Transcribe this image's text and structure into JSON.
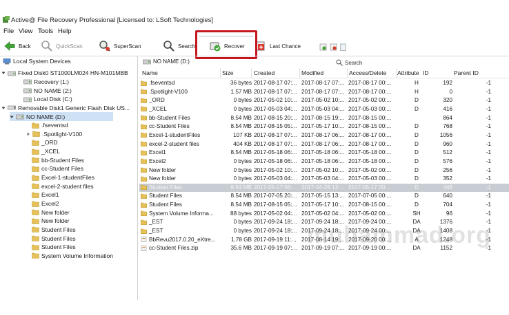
{
  "window": {
    "title": "Active@ File Recovery Professional [Licensed to: LSoft Technologies]"
  },
  "menu": [
    "File",
    "View",
    "Tools",
    "Help"
  ],
  "toolbar": {
    "back": "Back",
    "quickscan": "QuickScan",
    "superscan": "SuperScan",
    "search": "Search",
    "recover": "Recover",
    "last_chance": "Last Chance"
  },
  "tree": {
    "header": "Local System Devices",
    "nodes": [
      {
        "label": "Fixed Disk0 ST1000LM024 HN-M101MBB"
      },
      {
        "label": "Recovery (1:)"
      },
      {
        "label": "NO NAME (2:)"
      },
      {
        "label": "Local Disk (C:)"
      },
      {
        "label": "Removable Disk1 Generic Flash Disk US..."
      },
      {
        "label": "NO NAME (D:)"
      },
      {
        "label": ".fseventsd"
      },
      {
        "label": ".Spotlight-V100"
      },
      {
        "label": "_ORD"
      },
      {
        "label": "_XCEL"
      },
      {
        "label": "bb-Student Files"
      },
      {
        "label": "cc-Student Files"
      },
      {
        "label": "Excel-1-studentFiles"
      },
      {
        "label": "excel-2-student files"
      },
      {
        "label": "Excel1"
      },
      {
        "label": "Excel2"
      },
      {
        "label": "New folder"
      },
      {
        "label": "New folder"
      },
      {
        "label": "Student Files"
      },
      {
        "label": "Student Files"
      },
      {
        "label": "Student Files"
      },
      {
        "label": "System Volume Information"
      }
    ]
  },
  "path": {
    "current": "NO NAME (D:)",
    "search_tab": "Search"
  },
  "columns": {
    "name": "Name",
    "size": "Size",
    "created": "Created",
    "modified": "Modified",
    "accessed": "Access/Delete",
    "attribute": "Attribute",
    "id": "ID",
    "parent_id": "Parent ID"
  },
  "files": [
    {
      "name": ".fseventsd",
      "size": "36 bytes",
      "created": "2017-08-17 07:...",
      "modified": "2017-08-17 07:...",
      "accessed": "2017-08-17 00:...",
      "attr": "H",
      "id": "192",
      "pid": "-1"
    },
    {
      "name": ".Spotlight-V100",
      "size": "1.57 MB",
      "created": "2017-08-17 07:...",
      "modified": "2017-08-17 07:...",
      "accessed": "2017-08-17 00:...",
      "attr": "H",
      "id": "0",
      "pid": "-1"
    },
    {
      "name": "_ORD",
      "size": "0 bytes",
      "created": "2017-05-02 10:...",
      "modified": "2017-05-02 10:...",
      "accessed": "2017-05-02 00:...",
      "attr": "D",
      "id": "320",
      "pid": "-1"
    },
    {
      "name": "_XCEL",
      "size": "0 bytes",
      "created": "2017-05-03 04:...",
      "modified": "2017-05-03 04:...",
      "accessed": "2017-05-03 00:...",
      "attr": "D",
      "id": "416",
      "pid": "-1"
    },
    {
      "name": "bb-Student Files",
      "size": "8.54 MB",
      "created": "2017-08-15 20:...",
      "modified": "2017-08-15 19:...",
      "accessed": "2017-08-15 00:...",
      "attr": "",
      "id": "864",
      "pid": "-1"
    },
    {
      "name": "cc-Student Files",
      "size": "8.54 MB",
      "created": "2017-08-15 05:...",
      "modified": "2017-05-17 10:...",
      "accessed": "2017-08-15 00:...",
      "attr": "D",
      "id": "768",
      "pid": "-1"
    },
    {
      "name": "Excel-1-studentFiles",
      "size": "107 KB",
      "created": "2017-08-17 07:...",
      "modified": "2017-08-17 06:...",
      "accessed": "2017-08-17 00:...",
      "attr": "D",
      "id": "1056",
      "pid": "-1"
    },
    {
      "name": "excel-2-student files",
      "size": "404 KB",
      "created": "2017-08-17 07:...",
      "modified": "2017-08-17 06:...",
      "accessed": "2017-08-17 00:...",
      "attr": "D",
      "id": "960",
      "pid": "-1"
    },
    {
      "name": "Excel1",
      "size": "8.54 MB",
      "created": "2017-05-18 06:...",
      "modified": "2017-05-18 06:...",
      "accessed": "2017-05-18 00:...",
      "attr": "D",
      "id": "512",
      "pid": "-1"
    },
    {
      "name": "Excel2",
      "size": "0 bytes",
      "created": "2017-05-18 06:...",
      "modified": "2017-05-18 06:...",
      "accessed": "2017-05-18 00:...",
      "attr": "D",
      "id": "576",
      "pid": "-1"
    },
    {
      "name": "New folder",
      "size": "0 bytes",
      "created": "2017-05-02 10:...",
      "modified": "2017-05-02 10:...",
      "accessed": "2017-05-02 00:...",
      "attr": "D",
      "id": "256",
      "pid": "-1"
    },
    {
      "name": "New folder",
      "size": "0 bytes",
      "created": "2017-05-03 04:...",
      "modified": "2017-05-03 04:...",
      "accessed": "2017-05-03 00:...",
      "attr": "D",
      "id": "352",
      "pid": "-1"
    },
    {
      "name": "Student Files",
      "size": "8.54 MB",
      "created": "2017-05-17 06:...",
      "modified": "2017-04-29 13:...",
      "accessed": "2017-05-17 00:...",
      "attr": "D",
      "id": "448",
      "pid": "-1",
      "selected": true
    },
    {
      "name": "Student Files",
      "size": "8.54 MB",
      "created": "2017-07-05 20:...",
      "modified": "2017-05-15 13:...",
      "accessed": "2017-07-05 00:...",
      "attr": "D",
      "id": "640",
      "pid": "-1"
    },
    {
      "name": "Student Files",
      "size": "8.54 MB",
      "created": "2017-08-15 05:...",
      "modified": "2017-05-17 10:...",
      "accessed": "2017-08-15 00:...",
      "attr": "D",
      "id": "704",
      "pid": "-1"
    },
    {
      "name": "System Volume Informa...",
      "size": "88 bytes",
      "created": "2017-05-02 04:...",
      "modified": "2017-05-02 04:...",
      "accessed": "2017-05-02 00:...",
      "attr": "SH",
      "id": "96",
      "pid": "-1"
    },
    {
      "name": "_EST",
      "size": "0 bytes",
      "created": "2017-09-24 18:...",
      "modified": "2017-09-24 18:...",
      "accessed": "2017-09-24 00:...",
      "attr": "DA",
      "id": "1376",
      "pid": "-1"
    },
    {
      "name": "_EST",
      "size": "0 bytes",
      "created": "2017-09-24 18:...",
      "modified": "2017-09-24 18:...",
      "accessed": "2017-09-24 00:...",
      "attr": "DA",
      "id": "1408",
      "pid": "-1"
    },
    {
      "name": "BbRevu2017.0.20_eXtre...",
      "size": "1.78 GB",
      "created": "2017-09-19 11:...",
      "modified": "2017-08-14 19:...",
      "accessed": "2017-09-20 00:...",
      "attr": "A",
      "id": "1248",
      "pid": "-1"
    },
    {
      "name": "cc-Student Files.zip",
      "size": "35.6 MB",
      "created": "2017-09-19 07:...",
      "modified": "2017-09-19 07:...",
      "accessed": "2017-09-19 00:...",
      "attr": "DA",
      "id": "1152",
      "pid": "-1"
    }
  ],
  "watermark": "muhammad.org",
  "colors": {
    "highlight_border": "#c4161c",
    "selected_row": "#c8cdd3",
    "tree_selected": "#cfe1f5",
    "folder": "#e6c15a"
  }
}
